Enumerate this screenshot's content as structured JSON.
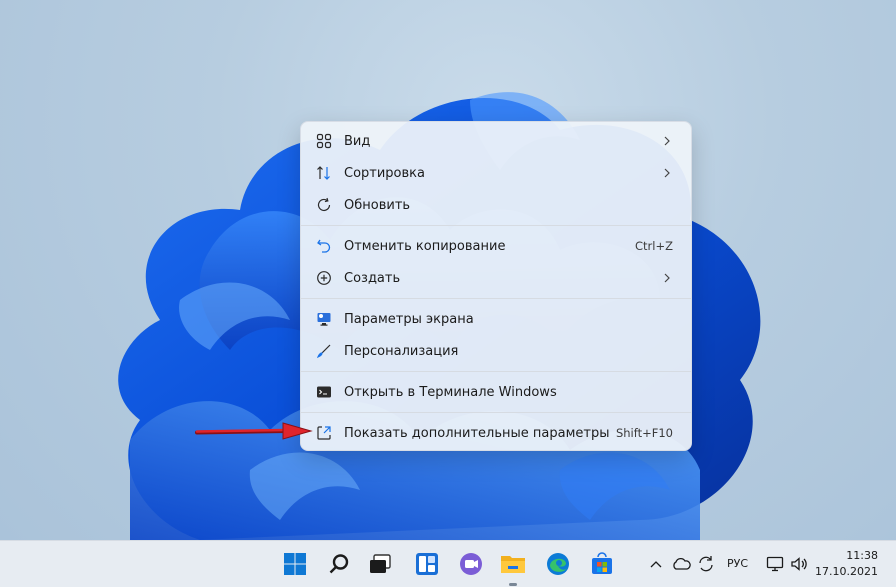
{
  "context_menu": {
    "items": [
      {
        "label": "Вид",
        "icon": "grid-icon"
      },
      {
        "label": "Сортировка",
        "icon": "sort-icon"
      },
      {
        "label": "Обновить",
        "icon": "refresh-icon"
      },
      {
        "label": "Отменить копирование",
        "shortcut": "Ctrl+Z",
        "icon": "undo-icon"
      },
      {
        "label": "Создать",
        "icon": "new-plus-icon"
      },
      {
        "label": "Параметры экрана",
        "icon": "display-settings-icon"
      },
      {
        "label": "Персонализация",
        "icon": "brush-icon"
      },
      {
        "label": "Открыть в Терминале Windows",
        "icon": "terminal-icon"
      },
      {
        "label": "Показать дополнительные параметры",
        "shortcut": "Shift+F10",
        "icon": "open-external-icon"
      }
    ]
  },
  "taskbar": {
    "apps": [
      "windows-start-icon",
      "search-icon",
      "task-view-icon",
      "widgets-icon",
      "teams-chat-icon",
      "file-explorer-icon",
      "edge-browser-icon",
      "store-icon"
    ],
    "tray": {
      "language": "РУС",
      "time": "11:38",
      "date": "17.10.2021"
    }
  },
  "colors": {
    "accent": "#1a73e8",
    "arrow": "#e0242b",
    "menu_bg": "#eef3f9",
    "taskbar_bg": "#e7ecf2"
  }
}
